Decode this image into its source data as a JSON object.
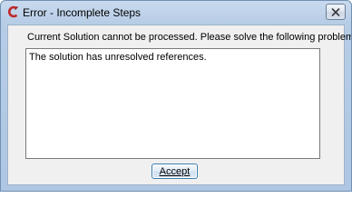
{
  "window": {
    "title": "Error - Incomplete Steps",
    "icon": "app-c-logo-icon",
    "close_icon": "close-icon"
  },
  "dialog": {
    "message": "Current Solution cannot be processed. Please solve the following problems and retry.",
    "problems_text": "The solution has unresolved references.",
    "accept_label": "Accept"
  },
  "colors": {
    "icon_red": "#c0282a",
    "title_bar": "#c9daee",
    "client_bg": "#f0f0f0"
  }
}
